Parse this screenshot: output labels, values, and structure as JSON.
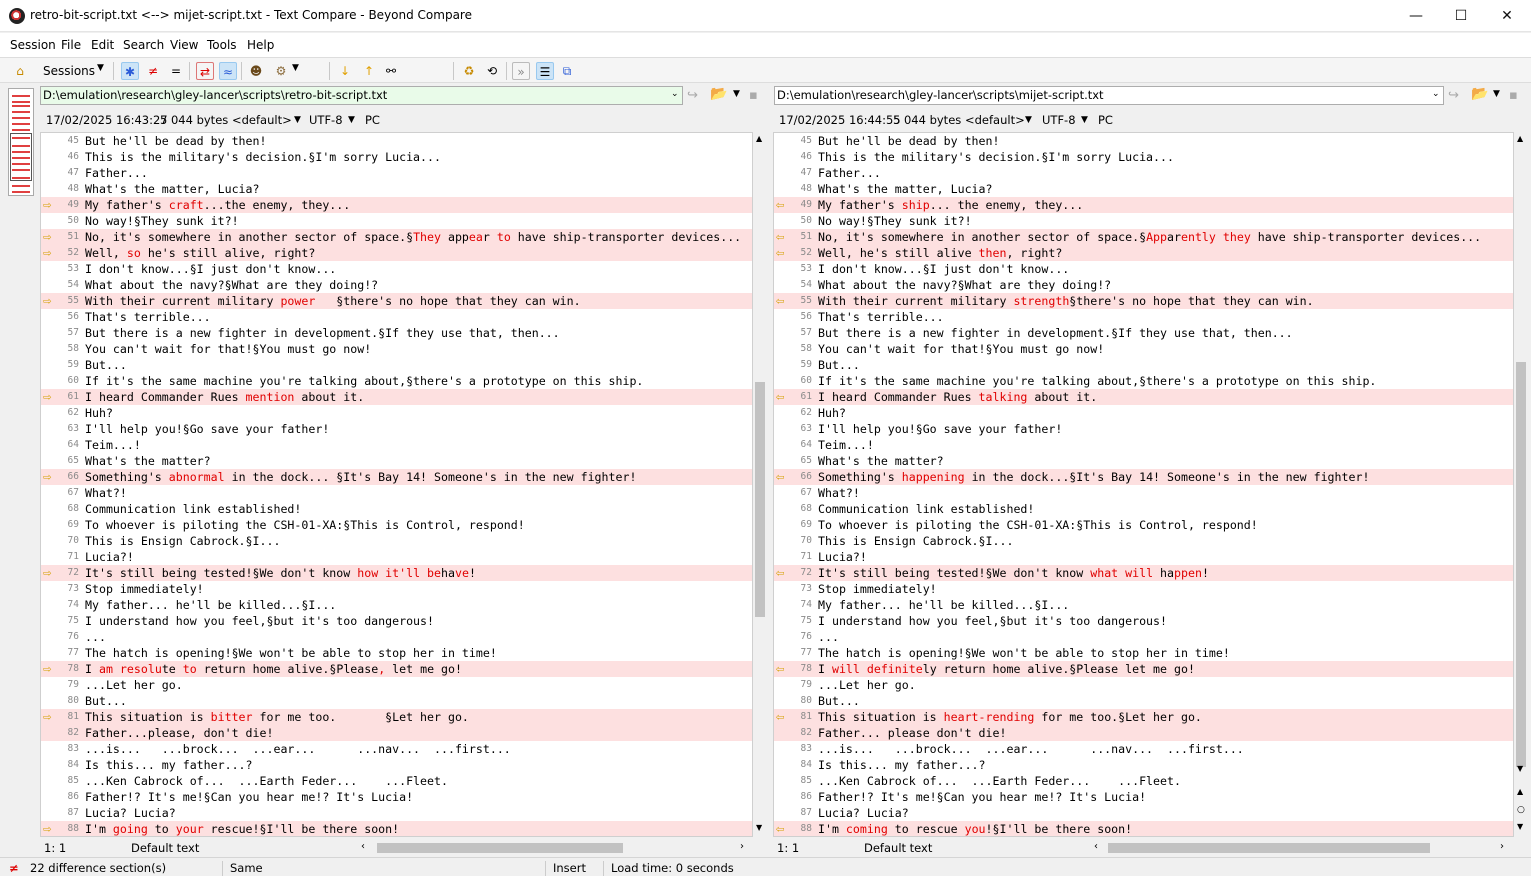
{
  "window": {
    "title": "retro-bit-script.txt <--> mijet-script.txt - Text Compare - Beyond Compare",
    "minimize": "—",
    "maximize": "☐",
    "close": "✕"
  },
  "menu": [
    "Session",
    "File",
    "Edit",
    "Search",
    "View",
    "Tools",
    "Help"
  ],
  "toolbar": {
    "sessions_label": "Sessions"
  },
  "left": {
    "path": "D:\\emulation\\research\\gley-lancer\\scripts\\retro-bit-script.txt",
    "date": "17/02/2025 16:43:27",
    "size": "5 044 bytes",
    "format": "<default>",
    "encoding": "UTF-8",
    "lineend": "PC",
    "position": "1: 1",
    "syntax": "Default text",
    "lines": [
      {
        "n": "45",
        "t": "But he'll be dead by then!"
      },
      {
        "n": "46",
        "t": "This is the military's decision.§I'm sorry Lucia..."
      },
      {
        "n": "47",
        "t": "Father..."
      },
      {
        "n": "48",
        "t": "What's the matter, Lucia?"
      },
      {
        "n": "49",
        "d": true,
        "parts": [
          {
            "t": "My father's "
          },
          {
            "t": "craft",
            "h": true
          },
          {
            "t": "...the enemy, they..."
          }
        ]
      },
      {
        "n": "50",
        "t": "No way!§They sunk it?!"
      },
      {
        "n": "51",
        "d": true,
        "parts": [
          {
            "t": "No, it's somewhere in another sector of space.§"
          },
          {
            "t": "They",
            "h": true
          },
          {
            "t": " app"
          },
          {
            "t": "ea",
            "h": true
          },
          {
            "t": "r "
          },
          {
            "t": "to",
            "h": true
          },
          {
            "t": " have ship-transporter devices..."
          }
        ]
      },
      {
        "n": "52",
        "d": true,
        "parts": [
          {
            "t": "Well, "
          },
          {
            "t": "so",
            "h": true
          },
          {
            "t": " he's still alive, right?"
          }
        ]
      },
      {
        "n": "53",
        "t": "I don't know...§I just don't know..."
      },
      {
        "n": "54",
        "t": "What about the navy?§What are they doing!?"
      },
      {
        "n": "55",
        "d": true,
        "parts": [
          {
            "t": "With their current military "
          },
          {
            "t": "power",
            "h": true
          },
          {
            "t": "   §there's no hope that they can win."
          }
        ]
      },
      {
        "n": "56",
        "t": "That's terrible..."
      },
      {
        "n": "57",
        "t": "But there is a new fighter in development.§If they use that, then..."
      },
      {
        "n": "58",
        "t": "You can't wait for that!§You must go now!"
      },
      {
        "n": "59",
        "t": "But..."
      },
      {
        "n": "60",
        "t": "If it's the same machine you're talking about,§there's a prototype on this ship."
      },
      {
        "n": "61",
        "d": true,
        "parts": [
          {
            "t": "I heard Commander Rues "
          },
          {
            "t": "mention",
            "h": true
          },
          {
            "t": " about it."
          }
        ]
      },
      {
        "n": "62",
        "t": "Huh?"
      },
      {
        "n": "63",
        "t": "I'll help you!§Go save your father!"
      },
      {
        "n": "64",
        "t": "Teim...!"
      },
      {
        "n": "65",
        "t": "What's the matter?"
      },
      {
        "n": "66",
        "d": true,
        "parts": [
          {
            "t": "Something's "
          },
          {
            "t": "abnormal",
            "h": true
          },
          {
            "t": " in the dock... §It's Bay 14! Someone's in the new fighter!"
          }
        ]
      },
      {
        "n": "67",
        "t": "What?!"
      },
      {
        "n": "68",
        "t": "Communication link established!"
      },
      {
        "n": "69",
        "t": "To whoever is piloting the CSH-01-XA:§This is Control, respond!"
      },
      {
        "n": "70",
        "t": "This is Ensign Cabrock.§I..."
      },
      {
        "n": "71",
        "t": "Lucia?!"
      },
      {
        "n": "72",
        "d": true,
        "parts": [
          {
            "t": "It's still being tested!§We don't know "
          },
          {
            "t": "how it'll",
            "h": true
          },
          {
            "t": " "
          },
          {
            "t": "be",
            "h": true
          },
          {
            "t": "ha"
          },
          {
            "t": "ve",
            "h": true
          },
          {
            "t": "!"
          }
        ]
      },
      {
        "n": "73",
        "t": "Stop immediately!"
      },
      {
        "n": "74",
        "t": "My father... he'll be killed...§I..."
      },
      {
        "n": "75",
        "t": "I understand how you feel,§but it's too dangerous!"
      },
      {
        "n": "76",
        "t": "..."
      },
      {
        "n": "77",
        "t": "The hatch is opening!§We won't be able to stop her in time!"
      },
      {
        "n": "78",
        "d": true,
        "parts": [
          {
            "t": "I "
          },
          {
            "t": "am",
            "h": true
          },
          {
            "t": " "
          },
          {
            "t": "resolu",
            "h": true
          },
          {
            "t": "te "
          },
          {
            "t": "to",
            "h": true
          },
          {
            "t": " return home alive.§Please"
          },
          {
            "t": ",",
            "h": true
          },
          {
            "t": " let me go!"
          }
        ]
      },
      {
        "n": "79",
        "t": "...Let her go."
      },
      {
        "n": "80",
        "t": "But..."
      },
      {
        "n": "81",
        "d": true,
        "parts": [
          {
            "t": "This situation is "
          },
          {
            "t": "bitter",
            "h": true
          },
          {
            "t": " for me too.       §Let her go."
          }
        ]
      },
      {
        "n": "82",
        "d": true,
        "parts": [
          {
            "t": "Father...please, don't die!"
          }
        ]
      },
      {
        "n": "83",
        "t": "...is...   ...brock...  ...ear...      ...nav...  ...first..."
      },
      {
        "n": "84",
        "t": "Is this... my father...?"
      },
      {
        "n": "85",
        "t": "...Ken Cabrock of...  ...Earth Feder...    ...Fleet."
      },
      {
        "n": "86",
        "t": "Father!? It's me!§Can you hear me!? It's Lucia!"
      },
      {
        "n": "87",
        "t": "Lucia? Lucia?"
      },
      {
        "n": "88",
        "d": true,
        "parts": [
          {
            "t": "I'm "
          },
          {
            "t": "going",
            "h": true
          },
          {
            "t": " to "
          },
          {
            "t": "your",
            "h": true
          },
          {
            "t": " rescue!§I'll be there soon!"
          }
        ]
      }
    ]
  },
  "right": {
    "path": "D:\\emulation\\research\\gley-lancer\\scripts\\mijet-script.txt",
    "date": "17/02/2025 16:44:55",
    "size": "5 044 bytes",
    "format": "<default>",
    "encoding": "UTF-8",
    "lineend": "PC",
    "position": "1: 1",
    "syntax": "Default text",
    "lines": [
      {
        "n": "45",
        "t": "But he'll be dead by then!"
      },
      {
        "n": "46",
        "t": "This is the military's decision.§I'm sorry Lucia..."
      },
      {
        "n": "47",
        "t": "Father..."
      },
      {
        "n": "48",
        "t": "What's the matter, Lucia?"
      },
      {
        "n": "49",
        "d": true,
        "parts": [
          {
            "t": "My father's "
          },
          {
            "t": "ship",
            "h": true
          },
          {
            "t": "... the enemy, they..."
          }
        ]
      },
      {
        "n": "50",
        "t": "No way!§They sunk it?!"
      },
      {
        "n": "51",
        "d": true,
        "parts": [
          {
            "t": "No, it's somewhere in another sector of space.§"
          },
          {
            "t": "App",
            "h": true
          },
          {
            "t": "ar"
          },
          {
            "t": "ently",
            "h": true
          },
          {
            "t": " "
          },
          {
            "t": "they",
            "h": true
          },
          {
            "t": " have ship-transporter devices..."
          }
        ]
      },
      {
        "n": "52",
        "d": true,
        "parts": [
          {
            "t": "Well, he's still alive "
          },
          {
            "t": "then",
            "h": true
          },
          {
            "t": ", right?"
          }
        ]
      },
      {
        "n": "53",
        "t": "I don't know...§I just don't know..."
      },
      {
        "n": "54",
        "t": "What about the navy?§What are they doing!?"
      },
      {
        "n": "55",
        "d": true,
        "parts": [
          {
            "t": "With their current military "
          },
          {
            "t": "strength",
            "h": true
          },
          {
            "t": "§there's no hope that they can win."
          }
        ]
      },
      {
        "n": "56",
        "t": "That's terrible..."
      },
      {
        "n": "57",
        "t": "But there is a new fighter in development.§If they use that, then..."
      },
      {
        "n": "58",
        "t": "You can't wait for that!§You must go now!"
      },
      {
        "n": "59",
        "t": "But..."
      },
      {
        "n": "60",
        "t": "If it's the same machine you're talking about,§there's a prototype on this ship."
      },
      {
        "n": "61",
        "d": true,
        "parts": [
          {
            "t": "I heard Commander Rues "
          },
          {
            "t": "talking",
            "h": true
          },
          {
            "t": " about it."
          }
        ]
      },
      {
        "n": "62",
        "t": "Huh?"
      },
      {
        "n": "63",
        "t": "I'll help you!§Go save your father!"
      },
      {
        "n": "64",
        "t": "Teim...!"
      },
      {
        "n": "65",
        "t": "What's the matter?"
      },
      {
        "n": "66",
        "d": true,
        "parts": [
          {
            "t": "Something's "
          },
          {
            "t": "happening",
            "h": true
          },
          {
            "t": " in the dock...§It's Bay 14! Someone's in the new fighter!"
          }
        ]
      },
      {
        "n": "67",
        "t": "What?!"
      },
      {
        "n": "68",
        "t": "Communication link established!"
      },
      {
        "n": "69",
        "t": "To whoever is piloting the CSH-01-XA:§This is Control, respond!"
      },
      {
        "n": "70",
        "t": "This is Ensign Cabrock.§I..."
      },
      {
        "n": "71",
        "t": "Lucia?!"
      },
      {
        "n": "72",
        "d": true,
        "parts": [
          {
            "t": "It's still being tested!§We don't know "
          },
          {
            "t": "what will",
            "h": true
          },
          {
            "t": " ha"
          },
          {
            "t": "ppen",
            "h": true
          },
          {
            "t": "!"
          }
        ]
      },
      {
        "n": "73",
        "t": "Stop immediately!"
      },
      {
        "n": "74",
        "t": "My father... he'll be killed...§I..."
      },
      {
        "n": "75",
        "t": "I understand how you feel,§but it's too dangerous!"
      },
      {
        "n": "76",
        "t": "..."
      },
      {
        "n": "77",
        "t": "The hatch is opening!§We won't be able to stop her in time!"
      },
      {
        "n": "78",
        "d": true,
        "parts": [
          {
            "t": "I "
          },
          {
            "t": "will definite",
            "h": true
          },
          {
            "t": "ly return home alive.§Please let me go!"
          }
        ]
      },
      {
        "n": "79",
        "t": "...Let her go."
      },
      {
        "n": "80",
        "t": "But..."
      },
      {
        "n": "81",
        "d": true,
        "parts": [
          {
            "t": "This situation is "
          },
          {
            "t": "heart-rending",
            "h": true
          },
          {
            "t": " for me too.§Let her go."
          }
        ]
      },
      {
        "n": "82",
        "d": true,
        "parts": [
          {
            "t": "Father... please don't die!"
          }
        ]
      },
      {
        "n": "83",
        "t": "...is...   ...brock...  ...ear...      ...nav...  ...first..."
      },
      {
        "n": "84",
        "t": "Is this... my father...?"
      },
      {
        "n": "85",
        "t": "...Ken Cabrock of...  ...Earth Feder...    ...Fleet."
      },
      {
        "n": "86",
        "t": "Father!? It's me!§Can you hear me!? It's Lucia!"
      },
      {
        "n": "87",
        "t": "Lucia? Lucia?"
      },
      {
        "n": "88",
        "d": true,
        "parts": [
          {
            "t": "I'm "
          },
          {
            "t": "coming",
            "h": true
          },
          {
            "t": " to rescue "
          },
          {
            "t": "you",
            "h": true
          },
          {
            "t": "!§I'll be there soon!"
          }
        ]
      }
    ]
  },
  "status": {
    "differences": "22 difference section(s)",
    "same": "Same",
    "mode": "Insert",
    "load": "Load time: 0 seconds"
  },
  "colors": {
    "diff_bg": "#fde0e0",
    "diff_text": "#e00000",
    "arrow": "#d4a000",
    "path_left_bg": "#e9fbe9"
  }
}
